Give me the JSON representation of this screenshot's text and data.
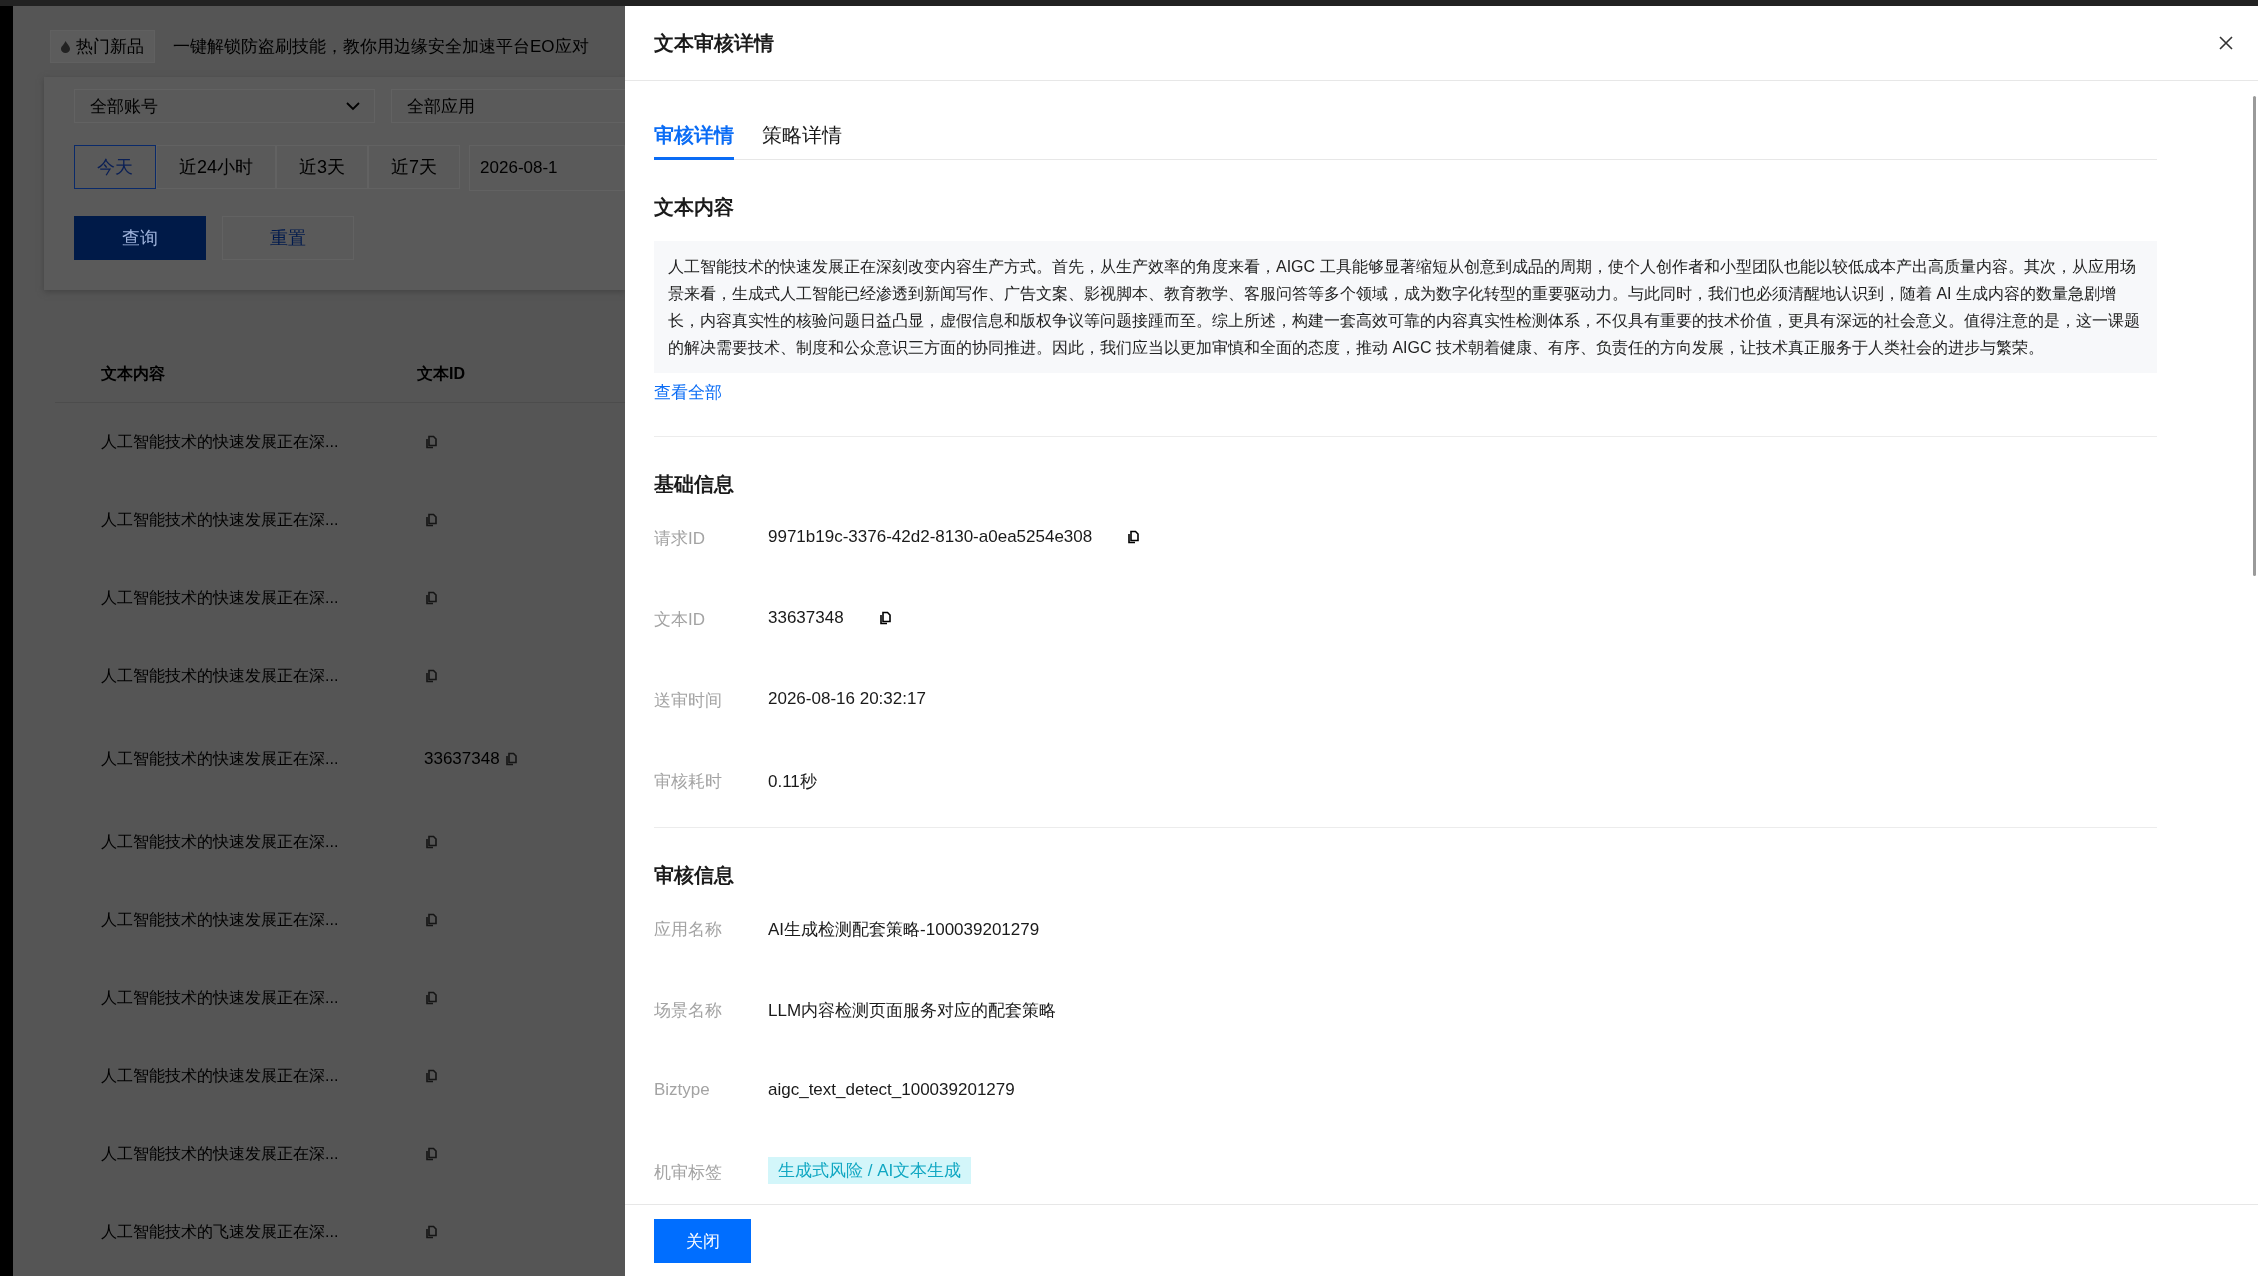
{
  "background_page": {
    "banner": {
      "badge": "热门新品",
      "text": "一键解锁防盗刷技能，教你用边缘安全加速平台EO应对"
    },
    "filters": [
      {
        "label": "全部账号",
        "kind": "dropdown"
      },
      {
        "label": "全部应用",
        "kind": "plain"
      }
    ],
    "time_ranges": [
      {
        "label": "今天",
        "selected": true
      },
      {
        "label": "近24小时",
        "selected": false
      },
      {
        "label": "近3天",
        "selected": false
      },
      {
        "label": "近7天",
        "selected": false
      }
    ],
    "date": "2026-08-1",
    "buttons": [
      {
        "label": "查询",
        "kind": "primary"
      },
      {
        "label": "重置",
        "kind": "secondary"
      }
    ],
    "table": {
      "columns": [
        "文本内容",
        "文本ID"
      ],
      "rows": [
        {
          "text": "人工智能技术的快速发展正在深..."
        },
        {
          "text": "人工智能技术的快速发展正在深..."
        },
        {
          "text": "人工智能技术的快速发展正在深..."
        },
        {
          "text": "人工智能技术的快速发展正在深..."
        },
        {
          "text": "人工智能技术的快速发展正在深...",
          "id": "33637348"
        },
        {
          "text": "人工智能技术的快速发展正在深..."
        },
        {
          "text": "人工智能技术的快速发展正在深..."
        },
        {
          "text": "人工智能技术的快速发展正在深..."
        },
        {
          "text": "人工智能技术的快速发展正在深..."
        },
        {
          "text": "人工智能技术的快速发展正在深..."
        },
        {
          "text": "人工智能技术的飞速发展正在深..."
        }
      ]
    }
  },
  "drawer": {
    "title": "文本审核详情",
    "tabs": [
      {
        "label": "审核详情",
        "selected": true
      },
      {
        "label": "策略详情",
        "selected": false
      }
    ],
    "text_section": {
      "title": "文本内容",
      "content": "人工智能技术的快速发展正在深刻改变内容生产方式。首先，从生产效率的角度来看，AIGC 工具能够显著缩短从创意到成品的周期，使个人创作者和小型团队也能以较低成本产出高质量内容。其次，从应用场景来看，生成式人工智能已经渗透到新闻写作、广告文案、影视脚本、教育教学、客服问答等多个领域，成为数字化转型的重要驱动力。与此同时，我们也必须清醒地认识到，随着 AI 生成内容的数量急剧增长，内容真实性的核验问题日益凸显，虚假信息和版权争议等问题接踵而至。综上所述，构建一套高效可靠的内容真实性检测体系，不仅具有重要的技术价值，更具有深远的社会意义。值得注意的是，这一课题的解决需要技术、制度和公众意识三方面的协同推进。因此，我们应当以更加审慎和全面的态度，推动 AIGC 技术朝着健康、有序、负责任的方向发展，让技术真正服务于人类社会的进步与繁荣。",
      "link": "查看全部"
    },
    "sections": [
      {
        "title": "基础信息",
        "fields": [
          {
            "label": "请求ID",
            "value": "9971b19c-3376-42d2-8130-a0ea5254e308",
            "kind": "copyable"
          },
          {
            "label": "文本ID",
            "value": "33637348",
            "kind": "copyable"
          },
          {
            "label": "送审时间",
            "value": "2026-08-16 20:32:17",
            "kind": "text"
          },
          {
            "label": "审核耗时",
            "value": "0.11秒",
            "kind": "text"
          }
        ]
      },
      {
        "title": "审核信息",
        "fields": [
          {
            "label": "应用名称",
            "value": "AI生成检测配套策略-100039201279",
            "kind": "text"
          },
          {
            "label": "场景名称",
            "value": "LLM内容检测页面服务对应的配套策略",
            "kind": "text"
          },
          {
            "label": "Biztype",
            "value": "aigc_text_detect_100039201279",
            "kind": "text"
          },
          {
            "label": "机审标签",
            "value": "生成式风险 / AI文本生成",
            "kind": "tag"
          }
        ]
      }
    ],
    "footer_button": "关闭"
  }
}
